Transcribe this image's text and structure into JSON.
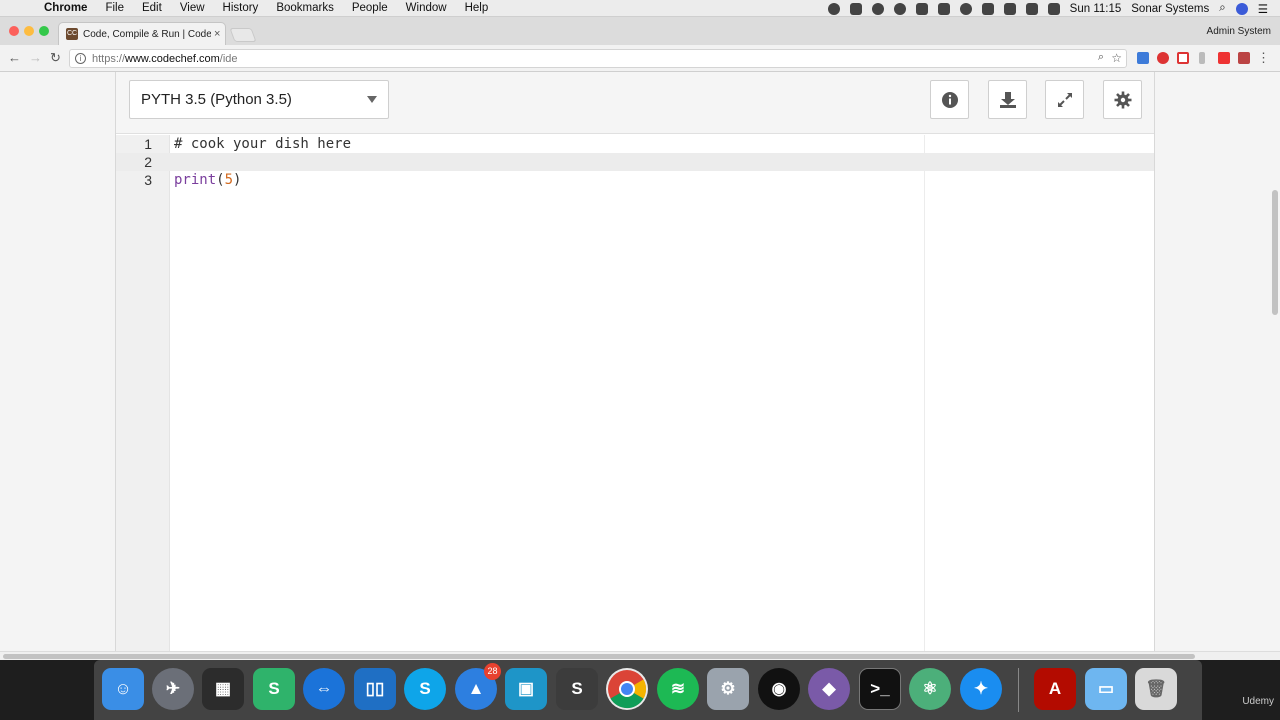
{
  "menubar": {
    "app": "Chrome",
    "items": [
      "File",
      "Edit",
      "View",
      "History",
      "Bookmarks",
      "People",
      "Window",
      "Help"
    ],
    "clock": "Sun 11:15",
    "user": "Sonar Systems"
  },
  "browser": {
    "tab_title": "Code, Compile & Run | CodeCh",
    "tab_favicon": "CC",
    "profile": "Admin System",
    "url_scheme": "https://",
    "url_host": "www.codechef.com",
    "url_path": "/ide"
  },
  "ide": {
    "language": "PYTH 3.5 (Python 3.5)",
    "lines": [
      {
        "number": "1",
        "code": "# cook your dish here"
      },
      {
        "number": "2",
        "code": ""
      },
      {
        "number": "3",
        "code_kw": "print",
        "code_open": "(",
        "code_num": "5",
        "code_close": ")"
      }
    ]
  },
  "dock": {
    "badge_count": "28",
    "watermark": "Udemy"
  }
}
